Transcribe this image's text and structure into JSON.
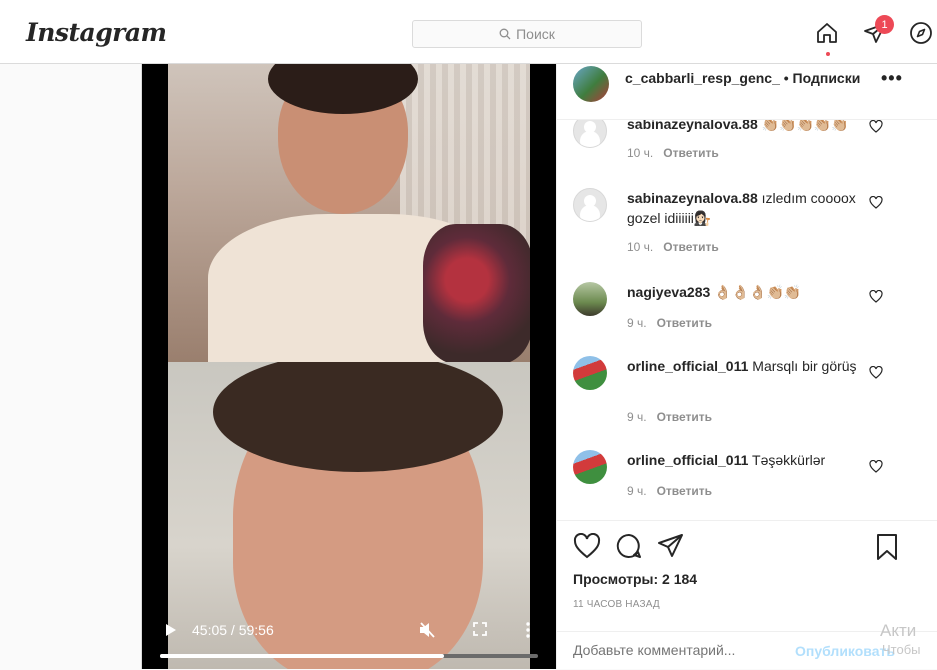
{
  "app": {
    "logo": "Instagram"
  },
  "search": {
    "placeholder": "Поиск"
  },
  "nav": {
    "home_icon": "home-icon",
    "direct_icon": "paper-plane-icon",
    "explore_icon": "compass-icon",
    "direct_badge": "1"
  },
  "post": {
    "author": "c_cabbarli_resp_genc_",
    "follow_label": "• Подписки",
    "video": {
      "time": "45:05 / 59:56",
      "progress": 0.752
    },
    "comments": [
      {
        "user": "sabinazeynalova.88",
        "text": "👏🏼👏🏼👏🏼👏🏼👏🏼",
        "time": "10 ч.",
        "reply": "Ответить"
      },
      {
        "user": "sabinazeynalova.88",
        "text": "ızledım coooox gozel idiiiiii👩🏻‍⚖️",
        "time": "10 ч.",
        "reply": "Ответить"
      },
      {
        "user": "nagiyeva283",
        "text": "👌🏼👌🏼👌🏼👏🏼👏🏼",
        "time": "9 ч.",
        "reply": "Ответить"
      },
      {
        "user": "orline_official_011",
        "text": "Marsqlı bir görüş",
        "time": "9 ч.",
        "reply": "Ответить"
      },
      {
        "user": "orline_official_011",
        "text": "Təşəkkürlər",
        "time": "9 ч.",
        "reply": "Ответить"
      }
    ],
    "views": "Просмотры: 2 184",
    "posted_ago": "11 ЧАСОВ НАЗАД",
    "comment_placeholder": "Добавьте комментарий...",
    "publish_label": "Опубликовать"
  },
  "windows_watermark": {
    "line1": "Акти",
    "line2": "Чтобы"
  }
}
